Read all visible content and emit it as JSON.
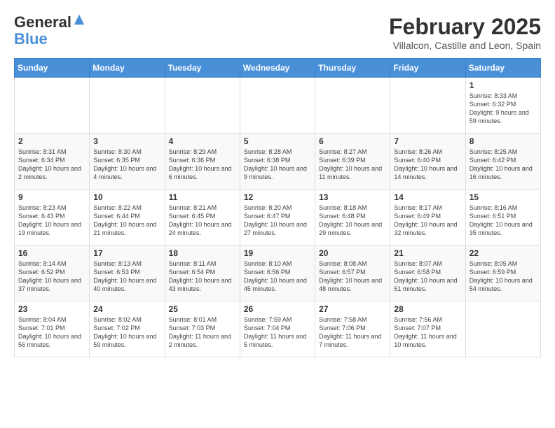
{
  "logo": {
    "line1": "General",
    "line2": "Blue"
  },
  "title": "February 2025",
  "subtitle": "Villalcon, Castille and Leon, Spain",
  "weekdays": [
    "Sunday",
    "Monday",
    "Tuesday",
    "Wednesday",
    "Thursday",
    "Friday",
    "Saturday"
  ],
  "weeks": [
    [
      {
        "day": "",
        "info": ""
      },
      {
        "day": "",
        "info": ""
      },
      {
        "day": "",
        "info": ""
      },
      {
        "day": "",
        "info": ""
      },
      {
        "day": "",
        "info": ""
      },
      {
        "day": "",
        "info": ""
      },
      {
        "day": "1",
        "info": "Sunrise: 8:33 AM\nSunset: 6:32 PM\nDaylight: 9 hours and 59 minutes."
      }
    ],
    [
      {
        "day": "2",
        "info": "Sunrise: 8:31 AM\nSunset: 6:34 PM\nDaylight: 10 hours and 2 minutes."
      },
      {
        "day": "3",
        "info": "Sunrise: 8:30 AM\nSunset: 6:35 PM\nDaylight: 10 hours and 4 minutes."
      },
      {
        "day": "4",
        "info": "Sunrise: 8:29 AM\nSunset: 6:36 PM\nDaylight: 10 hours and 6 minutes."
      },
      {
        "day": "5",
        "info": "Sunrise: 8:28 AM\nSunset: 6:38 PM\nDaylight: 10 hours and 9 minutes."
      },
      {
        "day": "6",
        "info": "Sunrise: 8:27 AM\nSunset: 6:39 PM\nDaylight: 10 hours and 11 minutes."
      },
      {
        "day": "7",
        "info": "Sunrise: 8:26 AM\nSunset: 6:40 PM\nDaylight: 10 hours and 14 minutes."
      },
      {
        "day": "8",
        "info": "Sunrise: 8:25 AM\nSunset: 6:42 PM\nDaylight: 10 hours and 16 minutes."
      }
    ],
    [
      {
        "day": "9",
        "info": "Sunrise: 8:23 AM\nSunset: 6:43 PM\nDaylight: 10 hours and 19 minutes."
      },
      {
        "day": "10",
        "info": "Sunrise: 8:22 AM\nSunset: 6:44 PM\nDaylight: 10 hours and 21 minutes."
      },
      {
        "day": "11",
        "info": "Sunrise: 8:21 AM\nSunset: 6:45 PM\nDaylight: 10 hours and 24 minutes."
      },
      {
        "day": "12",
        "info": "Sunrise: 8:20 AM\nSunset: 6:47 PM\nDaylight: 10 hours and 27 minutes."
      },
      {
        "day": "13",
        "info": "Sunrise: 8:18 AM\nSunset: 6:48 PM\nDaylight: 10 hours and 29 minutes."
      },
      {
        "day": "14",
        "info": "Sunrise: 8:17 AM\nSunset: 6:49 PM\nDaylight: 10 hours and 32 minutes."
      },
      {
        "day": "15",
        "info": "Sunrise: 8:16 AM\nSunset: 6:51 PM\nDaylight: 10 hours and 35 minutes."
      }
    ],
    [
      {
        "day": "16",
        "info": "Sunrise: 8:14 AM\nSunset: 6:52 PM\nDaylight: 10 hours and 37 minutes."
      },
      {
        "day": "17",
        "info": "Sunrise: 8:13 AM\nSunset: 6:53 PM\nDaylight: 10 hours and 40 minutes."
      },
      {
        "day": "18",
        "info": "Sunrise: 8:11 AM\nSunset: 6:54 PM\nDaylight: 10 hours and 43 minutes."
      },
      {
        "day": "19",
        "info": "Sunrise: 8:10 AM\nSunset: 6:56 PM\nDaylight: 10 hours and 45 minutes."
      },
      {
        "day": "20",
        "info": "Sunrise: 8:08 AM\nSunset: 6:57 PM\nDaylight: 10 hours and 48 minutes."
      },
      {
        "day": "21",
        "info": "Sunrise: 8:07 AM\nSunset: 6:58 PM\nDaylight: 10 hours and 51 minutes."
      },
      {
        "day": "22",
        "info": "Sunrise: 8:05 AM\nSunset: 6:59 PM\nDaylight: 10 hours and 54 minutes."
      }
    ],
    [
      {
        "day": "23",
        "info": "Sunrise: 8:04 AM\nSunset: 7:01 PM\nDaylight: 10 hours and 56 minutes."
      },
      {
        "day": "24",
        "info": "Sunrise: 8:02 AM\nSunset: 7:02 PM\nDaylight: 10 hours and 59 minutes."
      },
      {
        "day": "25",
        "info": "Sunrise: 8:01 AM\nSunset: 7:03 PM\nDaylight: 11 hours and 2 minutes."
      },
      {
        "day": "26",
        "info": "Sunrise: 7:59 AM\nSunset: 7:04 PM\nDaylight: 11 hours and 5 minutes."
      },
      {
        "day": "27",
        "info": "Sunrise: 7:58 AM\nSunset: 7:06 PM\nDaylight: 11 hours and 7 minutes."
      },
      {
        "day": "28",
        "info": "Sunrise: 7:56 AM\nSunset: 7:07 PM\nDaylight: 11 hours and 10 minutes."
      },
      {
        "day": "",
        "info": ""
      }
    ]
  ]
}
